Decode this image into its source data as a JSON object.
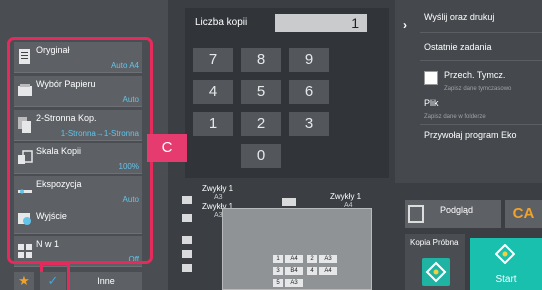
{
  "left_panel": {
    "items": [
      {
        "label": "Oryginał",
        "value": "Auto A4"
      },
      {
        "label": "Wybór Papieru",
        "value": "Auto"
      },
      {
        "label": "2-Stronna Kop.",
        "value": "1-Stronna→1-Stronna"
      },
      {
        "label": "Skala Kopii",
        "value": "100%"
      },
      {
        "label": "Ekspozycja",
        "value": "Auto"
      },
      {
        "label": "Wyjście",
        "value": ""
      },
      {
        "label": "N w 1",
        "value": "Off"
      }
    ],
    "other_label": "Inne"
  },
  "keypad": {
    "copies_label": "Liczba kopii",
    "copies_value": "1",
    "keys": [
      "7",
      "8",
      "9",
      "4",
      "5",
      "6",
      "1",
      "2",
      "3",
      "0"
    ],
    "clear_label": "C"
  },
  "right_menu": {
    "send_print": "Wyślij oraz drukuj",
    "recent_jobs": "Ostatnie zadania",
    "temp_save": "Przech. Tymcz.",
    "temp_save_sub": "Zapisz dane tymczasowo",
    "file": "Plik",
    "file_sub": "Zapisz dane w folderze",
    "eco_program": "Przywołaj program Eko"
  },
  "machine": {
    "tray1_label": "Zwykły 1",
    "tray1_size": "A3",
    "tray2_label": "Zwykły 1",
    "tray2_size": "A3",
    "tray3_label": "Zwykły 1",
    "tray3_size": "A4",
    "cassettes": [
      {
        "num": "1",
        "size": "A4"
      },
      {
        "num": "2",
        "size": "A3"
      },
      {
        "num": "3",
        "size": "B4"
      },
      {
        "num": "4",
        "size": "A4"
      },
      {
        "num": "5",
        "size": "A3"
      }
    ]
  },
  "actions": {
    "preview_label": "Podgląd",
    "ca_label": "CA",
    "proof_label": "Kopia Próbna",
    "start_label": "Start"
  },
  "colors": {
    "highlight_frame": "#e42b5c",
    "accent_value": "#63c3e8",
    "start": "#19c0ae",
    "clear_key": "#e53b6e"
  }
}
